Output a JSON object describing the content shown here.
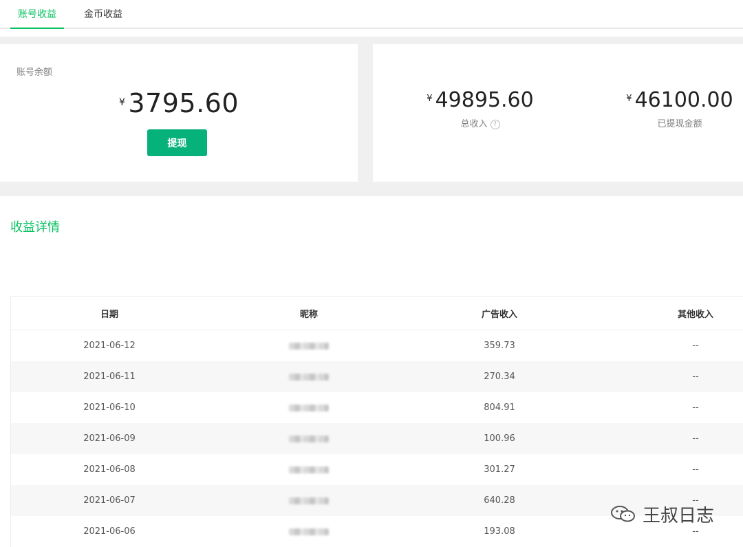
{
  "tabs": [
    {
      "label": "账号收益",
      "active": true
    },
    {
      "label": "金币收益",
      "active": false
    }
  ],
  "balance": {
    "label": "账号余额",
    "currency": "¥",
    "amount": "3795.60",
    "withdraw_label": "提现"
  },
  "stats": {
    "total_income": {
      "currency": "¥",
      "amount": "49895.60",
      "label": "总收入",
      "help_icon": "question-circle-icon"
    },
    "withdrawn": {
      "currency": "¥",
      "amount": "46100.00",
      "label": "已提现金额"
    }
  },
  "details": {
    "title": "收益详情",
    "columns": [
      "日期",
      "昵称",
      "广告收入",
      "其他收入"
    ],
    "rows": [
      {
        "date": "2021-06-12",
        "ad": "359.73",
        "other": "--"
      },
      {
        "date": "2021-06-11",
        "ad": "270.34",
        "other": "--"
      },
      {
        "date": "2021-06-10",
        "ad": "804.91",
        "other": "--"
      },
      {
        "date": "2021-06-09",
        "ad": "100.96",
        "other": "--"
      },
      {
        "date": "2021-06-08",
        "ad": "301.27",
        "other": "--"
      },
      {
        "date": "2021-06-07",
        "ad": "640.28",
        "other": "--"
      },
      {
        "date": "2021-06-06",
        "ad": "193.08",
        "other": "--"
      }
    ]
  },
  "watermark": {
    "text": "王叔日志",
    "icon": "wechat-icon"
  },
  "colors": {
    "accent": "#07c160",
    "button": "#07b17a",
    "band": "#f0f0f0"
  }
}
